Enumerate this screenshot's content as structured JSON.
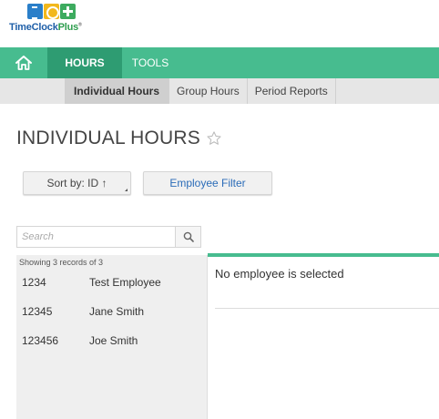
{
  "app": {
    "logo_text_main": "TimeClock",
    "logo_text_plus": "Plus",
    "logo_text_reg": "®"
  },
  "nav": {
    "home_icon": "home-icon",
    "tabs": [
      {
        "label": "HOURS",
        "active": true
      },
      {
        "label": "TOOLS",
        "active": false
      }
    ]
  },
  "subnav": {
    "items": [
      {
        "label": "Individual Hours",
        "active": true
      },
      {
        "label": "Group Hours",
        "active": false
      },
      {
        "label": "Period Reports",
        "active": false
      }
    ]
  },
  "page": {
    "title": "INDIVIDUAL HOURS",
    "favorite_icon": "star-outline-icon"
  },
  "toolbar": {
    "sort_label": "Sort by: ID ↑",
    "filter_label": "Employee Filter"
  },
  "search": {
    "placeholder": "Search",
    "value": "",
    "icon": "search-icon"
  },
  "list": {
    "count_text": "Showing 3 records of 3",
    "employees": [
      {
        "id": "1234",
        "name": "Test Employee"
      },
      {
        "id": "12345",
        "name": "Jane Smith"
      },
      {
        "id": "123456",
        "name": "Joe Smith"
      }
    ]
  },
  "detail": {
    "empty_message": "No employee is selected"
  },
  "colors": {
    "nav_green": "#47bc8f",
    "nav_active": "#2e9c72",
    "link_blue": "#2b6cb8"
  }
}
